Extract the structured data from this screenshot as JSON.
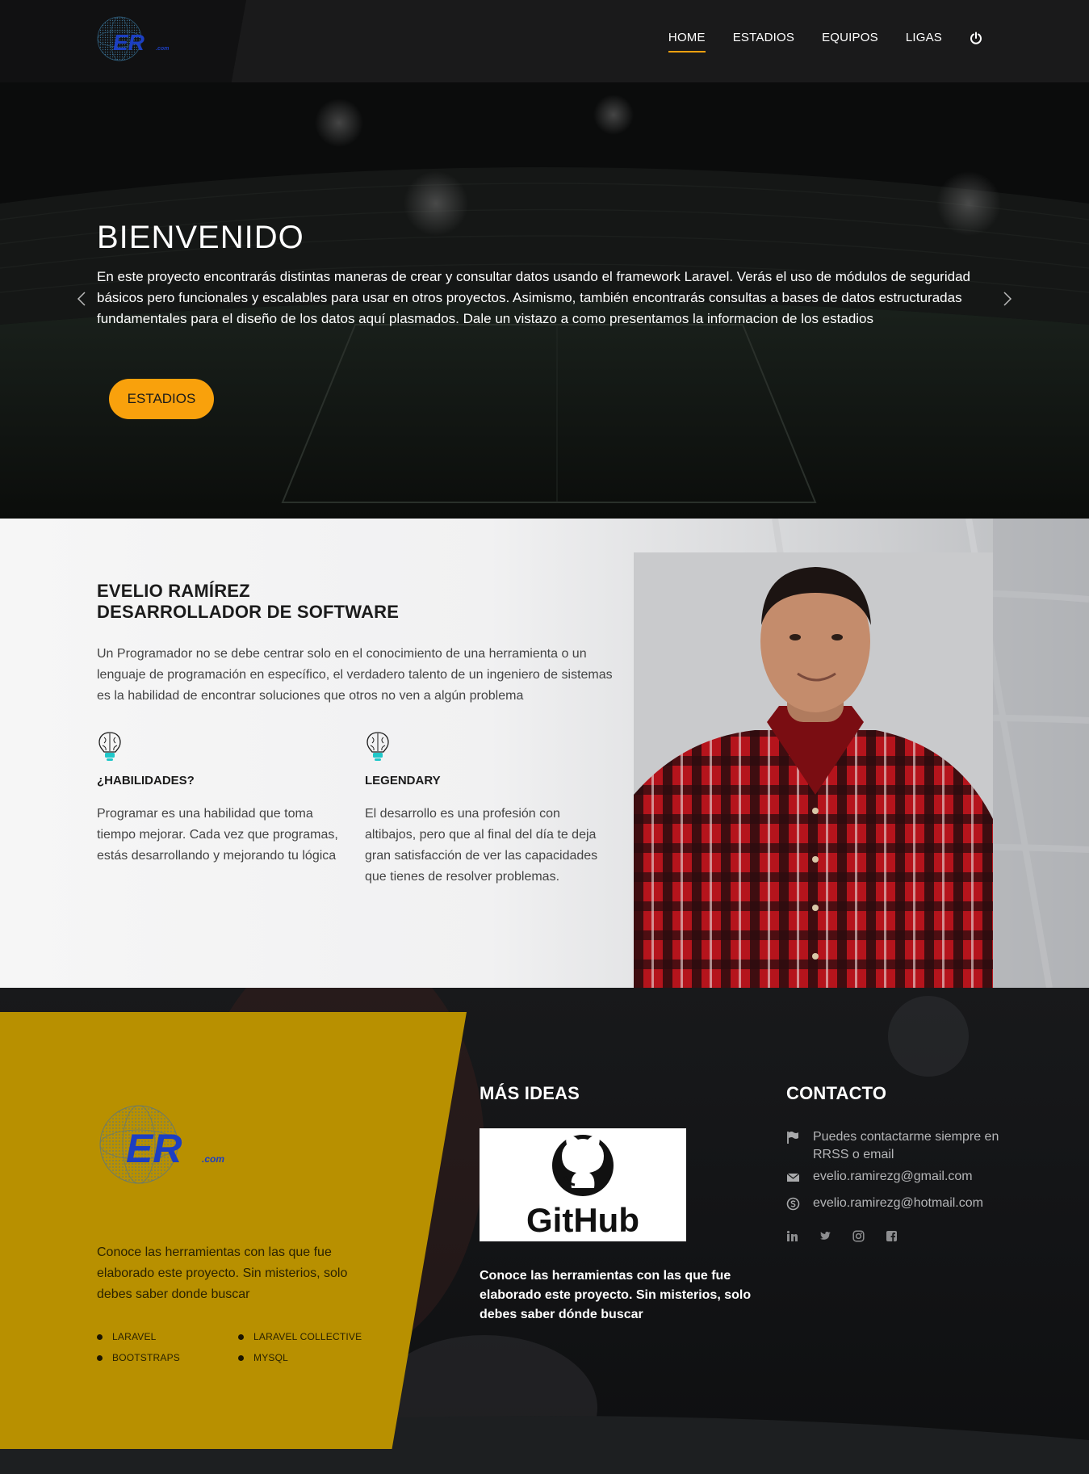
{
  "brand": {
    "logo_text": "ER",
    "logo_suffix": ".com",
    "logo_color": "#1c3fc2"
  },
  "nav": {
    "items": [
      {
        "label": "HOME",
        "active": true
      },
      {
        "label": "ESTADIOS",
        "active": false
      },
      {
        "label": "EQUIPOS",
        "active": false
      },
      {
        "label": "LIGAS",
        "active": false
      }
    ],
    "accent": "#f4a00f",
    "power_icon": "power-icon"
  },
  "hero": {
    "title": "BIENVENIDO",
    "text": "En este proyecto encontrarás distintas maneras de crear y consultar datos usando el framework Laravel. Verás el uso de módulos de seguridad básicos pero funcionales y escalables para usar en otros proyectos. Asimismo, también encontrarás consultas a bases de datos estructuradas fundamentales para el diseño de los datos aquí plasmados. Dale un vistazo a como presentamos la informacion de los estadios",
    "button_label": "ESTADIOS",
    "button_color": "#f9a10c",
    "prev_icon": "chevron-left-icon",
    "next_icon": "chevron-right-icon"
  },
  "about": {
    "name": "EVELIO RAMÍREZ",
    "role": "DESARROLLADOR DE SOFTWARE",
    "text": "Un Programador no se debe centrar solo en el conocimiento de una herramienta o un lenguaje de programación en específico, el verdadero talento de un ingeniero de sistemas es la habilidad de encontrar soluciones que otros no ven a algún problema",
    "features": [
      {
        "icon": "brain-bulb-icon",
        "title": "¿HABILIDADES?",
        "text": "Programar es una habilidad que toma tiempo mejorar. Cada vez que programas, estás desarrollando y mejorando tu lógica"
      },
      {
        "icon": "brain-bulb-icon",
        "title": "LEGENDARY",
        "text": "El desarrollo es una profesión con altibajos, pero que al final del día te deja gran satisfacción de ver las capacidades que tienes de resolver problemas."
      }
    ]
  },
  "footer": {
    "panel_color": "#b89000",
    "left_text": "Conoce las herramientas con las que fue elaborado este proyecto. Sin misterios, solo debes saber donde buscar",
    "tools": [
      "LARAVEL",
      "LARAVEL COLLECTIVE",
      "BOOTSTRAPS",
      "MYSQL"
    ],
    "ideas_title": "MÁS IDEAS",
    "github_label": "GitHub",
    "ideas_text": "Conoce las herramientas con las que fue elaborado este proyecto. Sin misterios, solo debes saber dónde buscar",
    "contact_title": "CONTACTO",
    "contacts": [
      {
        "icon": "flag-icon",
        "text": "Puedes contactarme siempre en RRSS o email"
      },
      {
        "icon": "envelope-icon",
        "text": "evelio.ramirezg@gmail.com"
      },
      {
        "icon": "skype-icon",
        "text": "evelio.ramirezg@hotmail.com"
      }
    ],
    "socials": [
      "linkedin-icon",
      "twitter-icon",
      "instagram-icon",
      "facebook-icon"
    ]
  }
}
